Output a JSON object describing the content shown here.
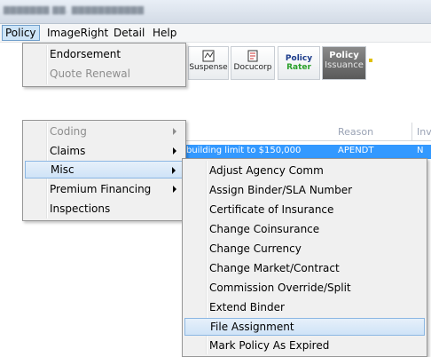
{
  "menubar": {
    "items": [
      {
        "label": "Policy"
      },
      {
        "label": "ImageRight"
      },
      {
        "label": "Detail"
      },
      {
        "label": "Help"
      }
    ]
  },
  "toolbar": {
    "buttons": [
      {
        "label": "Suspense",
        "icon": "suspense-icon"
      },
      {
        "label": "Docucorp",
        "icon": "docucorp-icon"
      },
      {
        "label_line1": "Policy",
        "label_line2": "Rater",
        "icon": "policy-rater-icon"
      },
      {
        "label_line1": "Policy",
        "label_line2": "Issuance",
        "icon": "policy-issuance-icon"
      }
    ]
  },
  "grid": {
    "columns": [
      "Reason",
      "Inv"
    ],
    "selected_row": {
      "description": "building limit to $150,000",
      "reason": "APENDT",
      "inv": "N"
    }
  },
  "policy_menu": {
    "top_items": [
      {
        "label": "Endorsement",
        "enabled": true
      },
      {
        "label": "Quote Renewal",
        "enabled": false
      }
    ],
    "items": [
      {
        "label": "Coding",
        "enabled": false,
        "submenu": true
      },
      {
        "label": "Claims",
        "enabled": true,
        "submenu": true
      },
      {
        "label": "Misc",
        "enabled": true,
        "submenu": true,
        "selected": true
      },
      {
        "label": "Premium Financing",
        "enabled": true,
        "submenu": true
      },
      {
        "label": "Inspections",
        "enabled": true,
        "submenu": false
      }
    ]
  },
  "misc_menu": {
    "items": [
      {
        "label": "Adjust Agency Comm"
      },
      {
        "label": "Assign Binder/SLA Number"
      },
      {
        "label": "Certificate of Insurance"
      },
      {
        "label": "Change Coinsurance"
      },
      {
        "label": "Change Currency"
      },
      {
        "label": "Change Market/Contract"
      },
      {
        "label": "Commission Override/Split"
      },
      {
        "label": "Extend Binder"
      },
      {
        "label": "File Assignment",
        "highlighted": true
      },
      {
        "label": "Mark Policy As Expired"
      }
    ]
  },
  "colors": {
    "selection": "#3399ff",
    "menu_highlight": "#cfe3f7"
  }
}
